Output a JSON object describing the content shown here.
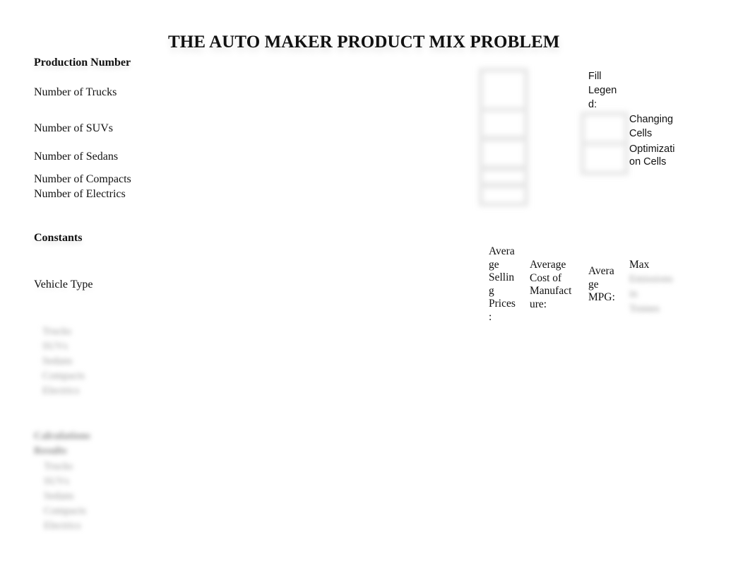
{
  "document": {
    "title": "THE AUTO MAKER PRODUCT MIX PROBLEM",
    "production": {
      "heading": "Production Number",
      "rows": [
        "Number of Trucks",
        "Number of SUVs",
        "Number of Sedans",
        "Number of Compacts",
        "Number of Electrics"
      ]
    },
    "legend": {
      "heading": "Fill Legend:",
      "heading_lines": [
        "Fill",
        "Legen",
        "d:"
      ],
      "items": [
        {
          "label_lines": [
            "Changing",
            "Cells"
          ]
        },
        {
          "label_lines": [
            "Optimizati",
            "on Cells"
          ]
        }
      ]
    },
    "constants": {
      "heading": "Constants",
      "vehicle_type_label": "Vehicle Type",
      "columns": [
        {
          "lines": [
            "Avera",
            "ge",
            "Sellin",
            "g",
            "Prices",
            ":"
          ]
        },
        {
          "lines": [
            "Average",
            "Cost of",
            "Manufact",
            "ure:"
          ]
        },
        {
          "lines": [
            "Avera",
            "ge",
            "MPG:"
          ]
        },
        {
          "lines": [
            "Max",
            "Emissions",
            "in",
            "Tonnes"
          ]
        }
      ],
      "blurred_vehicle_list": [
        "Trucks",
        "SUVs",
        "Sedans",
        "Compacts",
        "Electrics"
      ]
    },
    "calculations": {
      "blurred_heading_lines": [
        "Calculations",
        "Results"
      ],
      "blurred_list": [
        "Trucks",
        "SUVs",
        "Sedans",
        "Compacts",
        "Electrics"
      ]
    }
  }
}
